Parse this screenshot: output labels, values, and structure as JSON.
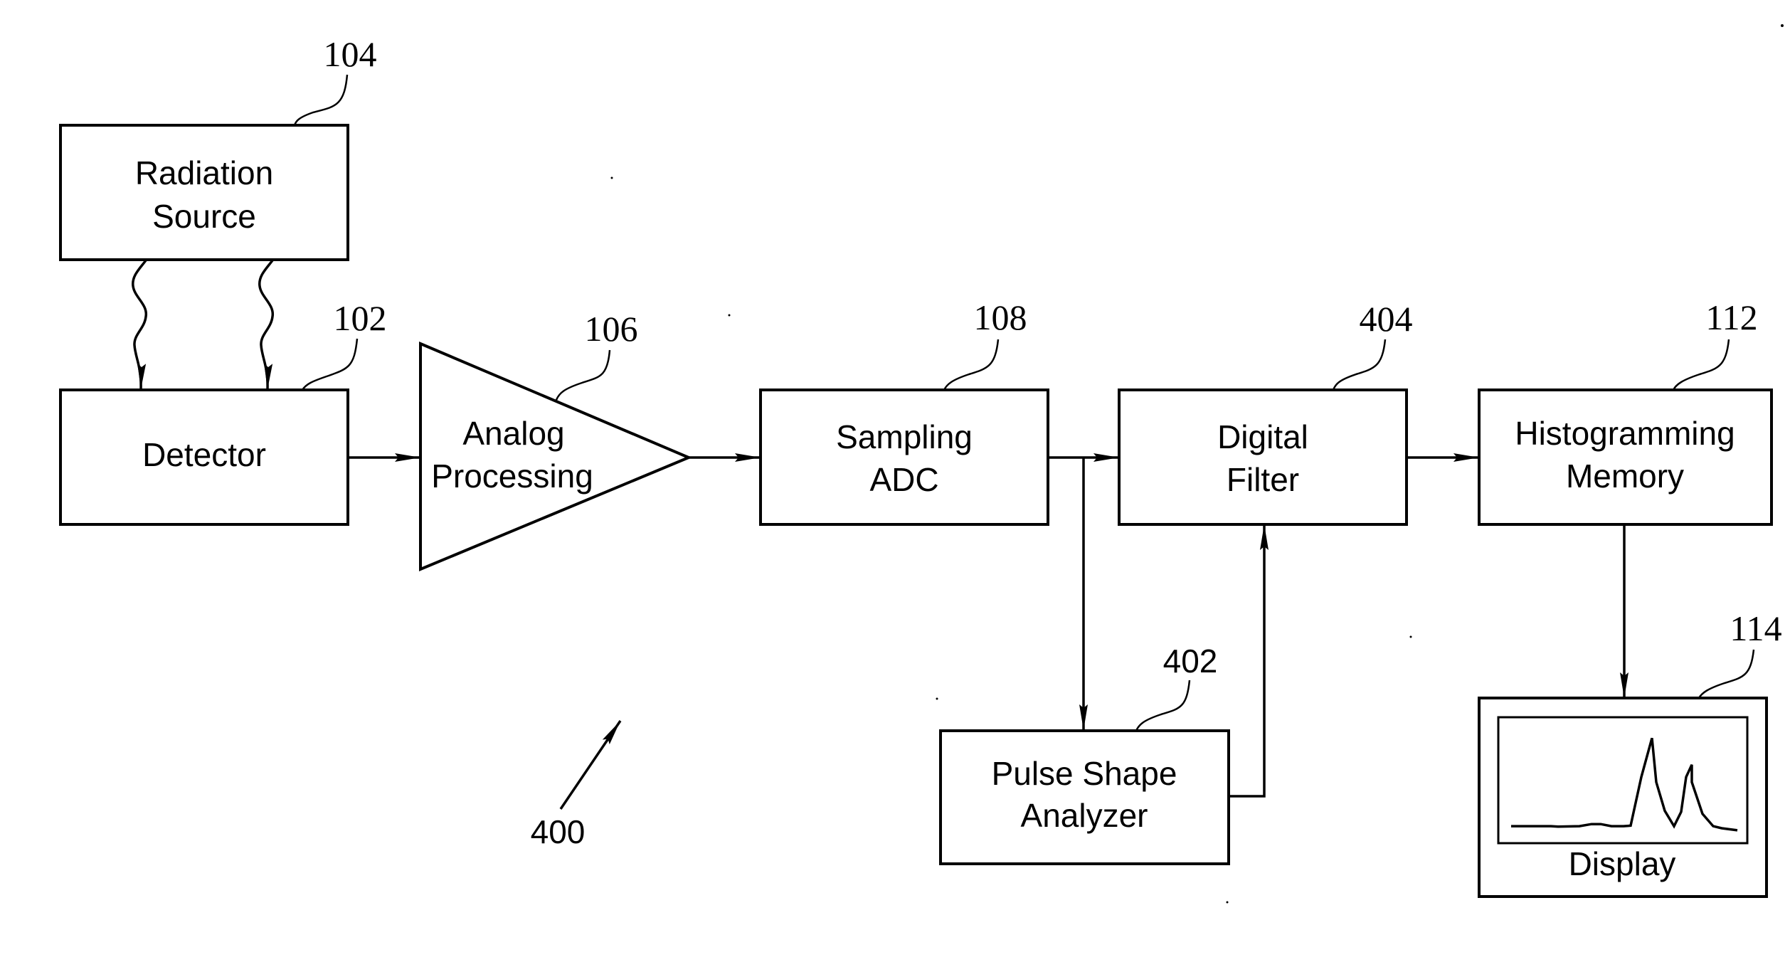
{
  "figure": {
    "reference_number": "400",
    "colors": {
      "ink": "#000000",
      "paper": "#ffffff"
    }
  },
  "blocks": {
    "radiation_source": {
      "ref": "104",
      "lines": [
        "Radiation",
        "Source"
      ]
    },
    "detector": {
      "ref": "102",
      "lines": [
        "Detector"
      ]
    },
    "analog_processing": {
      "ref": "106",
      "lines": [
        "Analog",
        "Processing"
      ],
      "shape": "triangle-amplifier"
    },
    "sampling_adc": {
      "ref": "108",
      "lines": [
        "Sampling",
        "ADC"
      ]
    },
    "digital_filter": {
      "ref": "404",
      "lines": [
        "Digital",
        "Filter"
      ]
    },
    "histogramming_memory": {
      "ref": "112",
      "lines": [
        "Histogramming",
        "Memory"
      ]
    },
    "pulse_shape_analyzer": {
      "ref": "402",
      "lines": [
        "Pulse Shape",
        "Analyzer"
      ]
    },
    "display": {
      "ref": "114",
      "lines": [
        "Display"
      ]
    }
  },
  "connections": [
    {
      "from": "radiation_source",
      "to": "detector",
      "style": "wavy",
      "count": 2
    },
    {
      "from": "detector",
      "to": "analog_processing",
      "style": "arrow"
    },
    {
      "from": "analog_processing",
      "to": "sampling_adc",
      "style": "arrow"
    },
    {
      "from": "sampling_adc",
      "to": "digital_filter",
      "style": "arrow"
    },
    {
      "from": "sampling_adc",
      "to": "pulse_shape_analyzer",
      "style": "arrow"
    },
    {
      "from": "pulse_shape_analyzer",
      "to": "digital_filter",
      "style": "arrow"
    },
    {
      "from": "digital_filter",
      "to": "histogramming_memory",
      "style": "arrow"
    },
    {
      "from": "histogramming_memory",
      "to": "display",
      "style": "arrow"
    }
  ],
  "display_spectrum": {
    "description": "energy spectrum with two peaks, taller first peak",
    "relative_values": [
      0.02,
      0.02,
      0.015,
      0.02,
      0.04,
      0.04,
      0.02,
      0.02,
      0.025,
      0.5,
      0.88,
      0.45,
      0.17,
      0.02,
      0.16,
      0.5,
      0.62,
      0.45,
      0.14,
      0.02,
      0.0,
      -0.02
    ]
  }
}
